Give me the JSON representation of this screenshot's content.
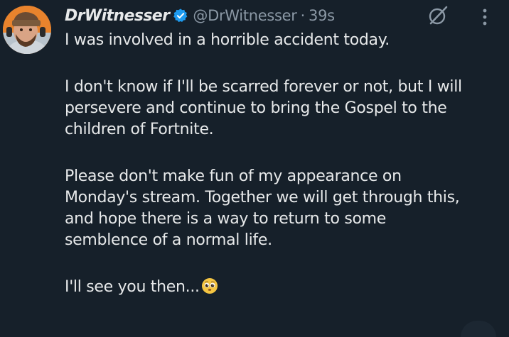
{
  "post": {
    "display_name": "DrWitnesser",
    "handle": "@DrWitnesser",
    "separator": "·",
    "timestamp": "39s",
    "verified": true,
    "lines": [
      "I was involved in a horrible accident today.",
      "I don't know if I'll be scarred forever or not, but I will",
      "persevere and continue to bring the Gospel to the",
      "children of Fortnite.",
      "Please don't make fun of my appearance on",
      "Monday's stream. Together we will get through this,",
      "and hope there is a way to return to some",
      "semblence of a normal life.",
      "I'll see you then..."
    ],
    "emoji": "pleading-face-emoji"
  },
  "icons": {
    "verified": "verified-badge-icon",
    "grok": "grok-icon",
    "more": "more-options-icon"
  },
  "colors": {
    "background": "#15202b",
    "text": "#e7e9ea",
    "secondary_text": "#8b98a5",
    "verified_blue": "#1d9bf0"
  }
}
